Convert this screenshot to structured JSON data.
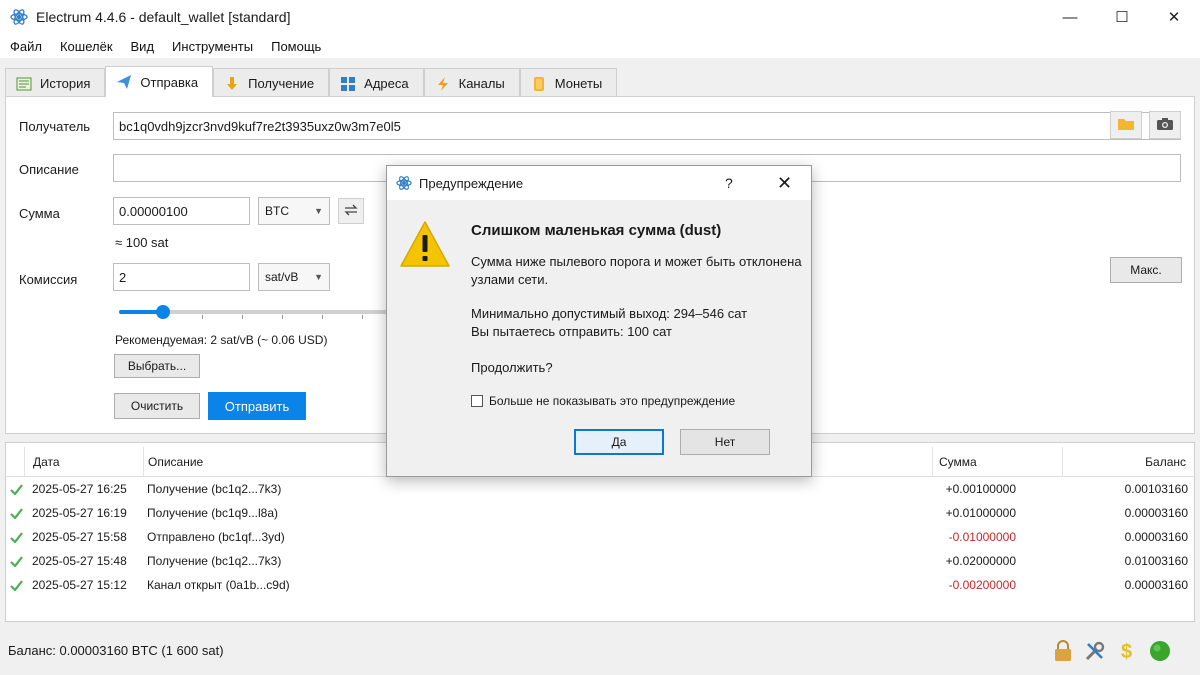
{
  "window": {
    "title": "Electrum 4.4.6  -  default_wallet  [standard]",
    "minimize": "—",
    "maximize": "☐",
    "close": "✕"
  },
  "menu": [
    "Файл",
    "Кошелёк",
    "Вид",
    "Инструменты",
    "Помощь"
  ],
  "tabs": [
    {
      "label": "История",
      "icon": "history-icon"
    },
    {
      "label": "Отправка",
      "icon": "send-icon"
    },
    {
      "label": "Получение",
      "icon": "receive-icon"
    },
    {
      "label": "Адреса",
      "icon": "addresses-icon"
    },
    {
      "label": "Каналы",
      "icon": "lightning-icon"
    },
    {
      "label": "Монеты",
      "icon": "coins-icon"
    }
  ],
  "send": {
    "recipient_label": "Получатель",
    "recipient_value": "bc1q0vdh9jzcr3nvd9kuf7re2t3935uxz0w3m7e0l5",
    "description_label": "Описание",
    "description_value": "",
    "amount_label": "Сумма",
    "amount_value": "0.00000100",
    "amount_unit": "BTC",
    "amount_sat": "≈ 100 sat",
    "fee_label": "Комиссия",
    "fee_value": "2",
    "fee_unit": "sat/vB",
    "max_button": "Макс.",
    "fee_slider_fraction": 0.16,
    "recommended": "Рекомендуемая:  2 sat/vB (~ 0.06 USD)",
    "choose_button": "Выбрать...",
    "clear_button": "Очистить",
    "send_button": "Отправить"
  },
  "history": {
    "columns": [
      "Дата",
      "Описание",
      "Сумма",
      "Баланс"
    ],
    "rows": [
      {
        "date": "2025-05-27 16:25",
        "desc": "Получение (bc1q2...7k3)",
        "amount": "+0.00100000",
        "balance": "0.00103160",
        "negative": false
      },
      {
        "date": "2025-05-27 16:19",
        "desc": "Получение (bc1q9...l8a)",
        "amount": "+0.01000000",
        "balance": "0.00003160",
        "negative": false
      },
      {
        "date": "2025-05-27 15:58",
        "desc": "Отправлено (bc1qf...3yd)",
        "amount": "-0.01000000",
        "balance": "0.00003160",
        "negative": true
      },
      {
        "date": "2025-05-27 15:48",
        "desc": "Получение (bc1q2...7k3)",
        "amount": "+0.02000000",
        "balance": "0.01003160",
        "negative": false
      },
      {
        "date": "2025-05-27 15:12",
        "desc": "Канал открыт (0a1b...c9d)",
        "amount": "-0.00200000",
        "balance": "0.00003160",
        "negative": true
      }
    ]
  },
  "status": {
    "balance": "Баланс: 0.00003160 BTC (1 600 sat)",
    "icons": [
      "lock-icon",
      "tools-icon",
      "dollar-icon",
      "network-status-icon"
    ]
  },
  "dialog": {
    "title": "Предупреждение",
    "help": "?",
    "close": "✕",
    "heading": "Слишком маленькая сумма (dust)",
    "line1": "Сумма ниже пылевого порога и может быть отклонена",
    "line2": "узлами сети.",
    "line3": "Минимально допустимый выход: 294–546 сат",
    "line4": "Вы пытаетесь отправить: 100 сат",
    "line5": "Продолжить?",
    "checkbox_label": "Больше не показывать это предупреждение",
    "yes_button": "Да",
    "no_button": "Нет"
  },
  "colors": {
    "accent": "#0a84e8",
    "negative": "#c62828",
    "ok_check": "#4caf50",
    "warning": "#f5c400"
  }
}
